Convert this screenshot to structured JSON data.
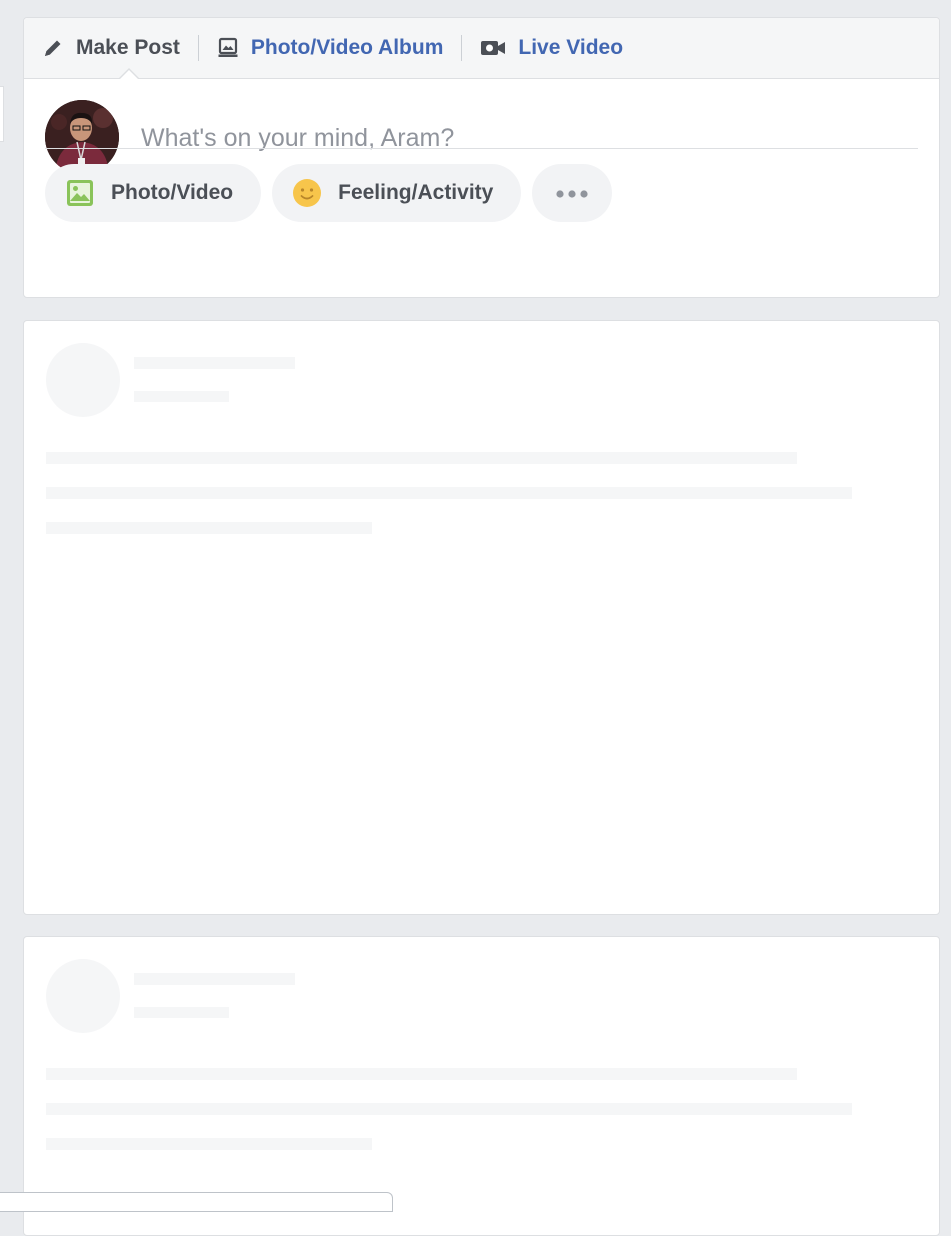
{
  "composer": {
    "tabs": [
      {
        "label": "Make Post",
        "icon": "pencil-icon"
      },
      {
        "label": "Photo/Video Album",
        "icon": "photo-album-icon"
      },
      {
        "label": "Live Video",
        "icon": "video-camera-icon"
      }
    ],
    "user_name": "Aram",
    "placeholder": "What's on your mind, Aram?",
    "actions": [
      {
        "label": "Photo/Video",
        "icon": "image-icon"
      },
      {
        "label": "Feeling/Activity",
        "icon": "smiley-icon"
      },
      {
        "label": "",
        "icon": "more-icon"
      }
    ]
  },
  "feed": {
    "placeholder_cards": 2,
    "state": "loading"
  },
  "colors": {
    "page_background": "#e9ebee",
    "link_blue": "#4267b2",
    "text_dark": "#4b4f56",
    "placeholder_grey": "#90949c",
    "skeleton_grey": "#f5f6f7",
    "photo_icon_green": "#8ac35a",
    "smiley_yellow": "#f7c54b"
  }
}
